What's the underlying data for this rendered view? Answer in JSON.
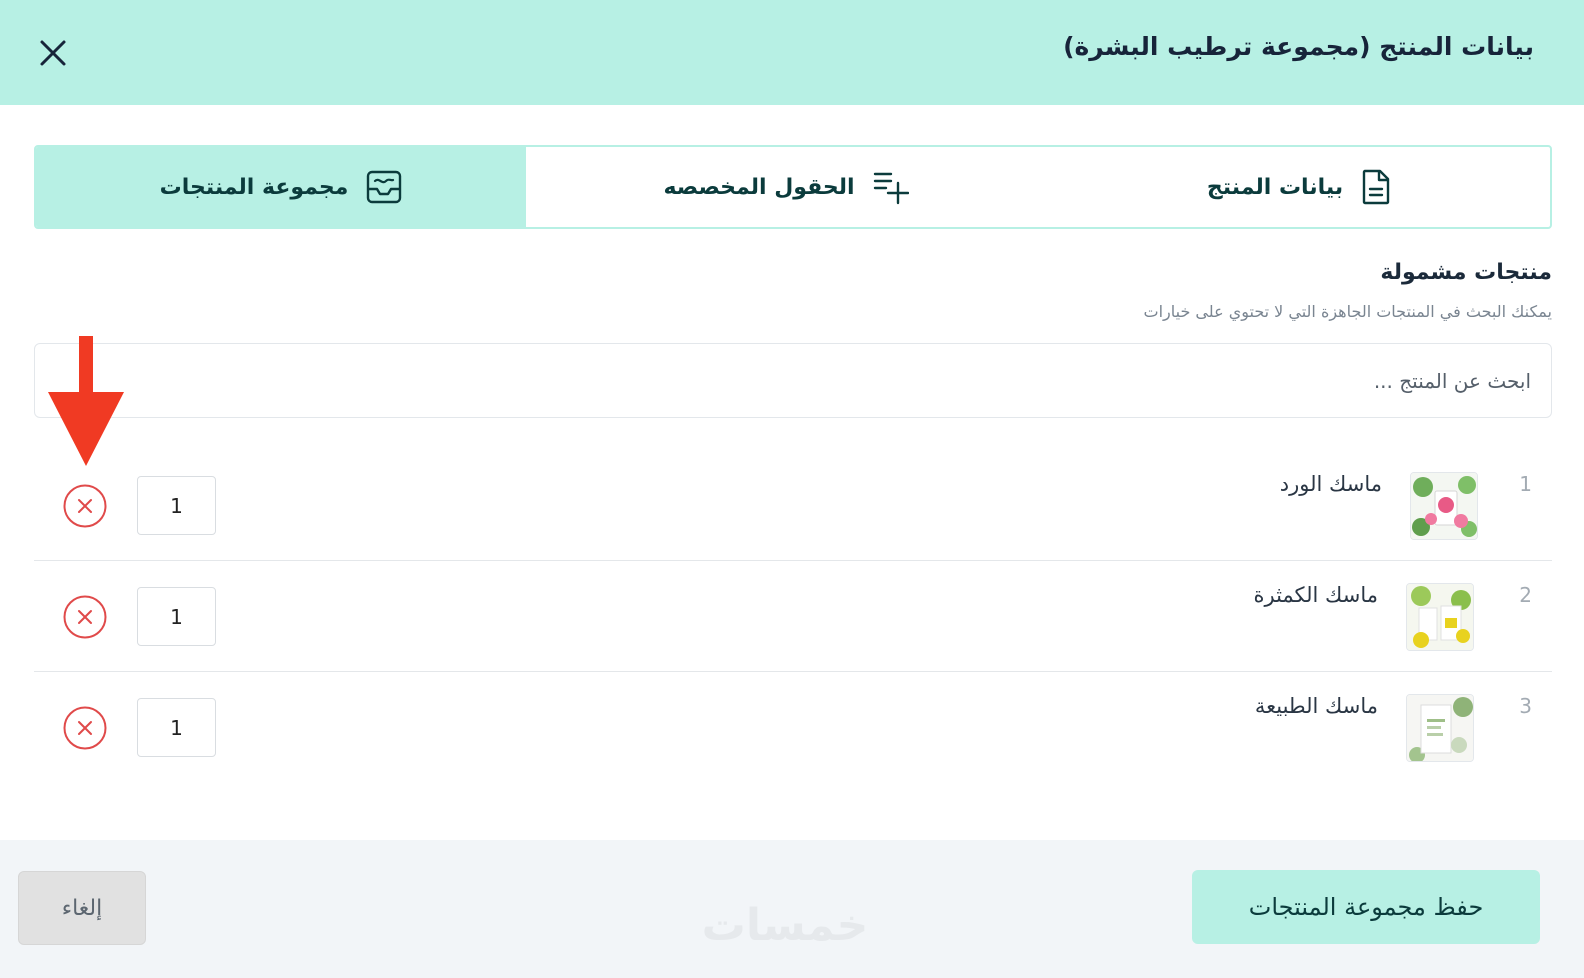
{
  "header": {
    "title": "بيانات المنتج (مجموعة ترطيب البشرة)"
  },
  "tabs": [
    {
      "label": "بيانات المنتج",
      "icon": "document-icon",
      "active": false
    },
    {
      "label": "الحقول المخصصه",
      "icon": "list-add-icon",
      "active": false
    },
    {
      "label": "مجموعة المنتجات",
      "icon": "inbox-icon",
      "active": true
    }
  ],
  "section": {
    "title": "منتجات مشمولة",
    "hint": "يمكنك البحث في المنتجات الجاهزة التي لا تحتوي على خيارات"
  },
  "search": {
    "placeholder": "ابحث عن المنتج ...",
    "value": ""
  },
  "products": [
    {
      "index": "1",
      "name": "ماسك الورد",
      "quantity": "1",
      "thumb_color": "#e85a86"
    },
    {
      "index": "2",
      "name": "ماسك الكمثرة",
      "quantity": "1",
      "thumb_color": "#e8d21f"
    },
    {
      "index": "3",
      "name": "ماسك الطبيعة",
      "quantity": "1",
      "thumb_color": "#9fbf88"
    }
  ],
  "footer": {
    "save_label": "حفظ مجموعة المنتجات",
    "cancel_label": "إلغاء",
    "watermark": "خمسات"
  },
  "colors": {
    "accent": "#b7f0e4",
    "remove": "#e04a4a",
    "arrow": "#f03a23"
  }
}
